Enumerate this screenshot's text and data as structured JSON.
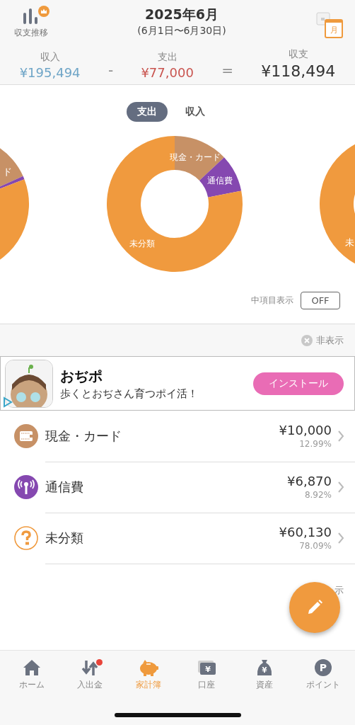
{
  "header": {
    "trend_label": "収支推移",
    "title": "2025年6月",
    "period": "(6月1日〜6月30日)",
    "calendar_label": "月"
  },
  "summary": [
    {
      "kind": "income",
      "label": "収入",
      "value": "¥195,494"
    },
    {
      "kind": "expense",
      "label": "支出",
      "value": "¥77,000"
    },
    {
      "kind": "balance",
      "label": "収支",
      "value": "¥118,494"
    }
  ],
  "operators": [
    "-",
    "="
  ],
  "segments": [
    {
      "label": "支出",
      "selected": true
    },
    {
      "label": "収入",
      "selected": false
    }
  ],
  "chart_data": {
    "type": "donut",
    "categories": [
      "現金・カード",
      "通信費",
      "未分類"
    ],
    "series": [
      {
        "values": [
          12.99,
          8.92,
          78.09
        ]
      }
    ],
    "colors": [
      "#c79166",
      "#8548b0",
      "#f09a3e"
    ]
  },
  "side_charts": [
    {
      "label": "ド"
    },
    {
      "label": "未"
    }
  ],
  "sub_items": {
    "label": "中項目表示",
    "value": "OFF"
  },
  "ad_hide": "非表示",
  "ad": {
    "title": "おぢポ",
    "tagline": "歩くとおぢさん育つポイ活！",
    "button": "インストール"
  },
  "categories": [
    {
      "kind": "wallet",
      "name": "現金・カード",
      "amount": "¥10,000",
      "percent": "12.99%",
      "color": "#c79166"
    },
    {
      "kind": "antenna",
      "name": "通信費",
      "amount": "¥6,870",
      "percent": "8.92%",
      "color": "#8548b0"
    },
    {
      "kind": "question",
      "name": "未分類",
      "amount": "¥60,130",
      "percent": "78.09%",
      "color": "#f09a3e"
    }
  ],
  "list_hide": "示",
  "tabbar": [
    {
      "kind": "home",
      "label": "ホーム",
      "selected": false,
      "badge": false
    },
    {
      "kind": "transfer",
      "label": "入出金",
      "selected": false,
      "badge": true
    },
    {
      "kind": "piggy",
      "label": "家計簿",
      "selected": true,
      "badge": false
    },
    {
      "kind": "account",
      "label": "口座",
      "selected": false,
      "badge": false,
      "glyph": "¥"
    },
    {
      "kind": "assets",
      "label": "資産",
      "selected": false,
      "badge": false,
      "glyph": "¥"
    },
    {
      "kind": "point",
      "label": "ポイント",
      "selected": false,
      "badge": false,
      "glyph": "P"
    }
  ]
}
